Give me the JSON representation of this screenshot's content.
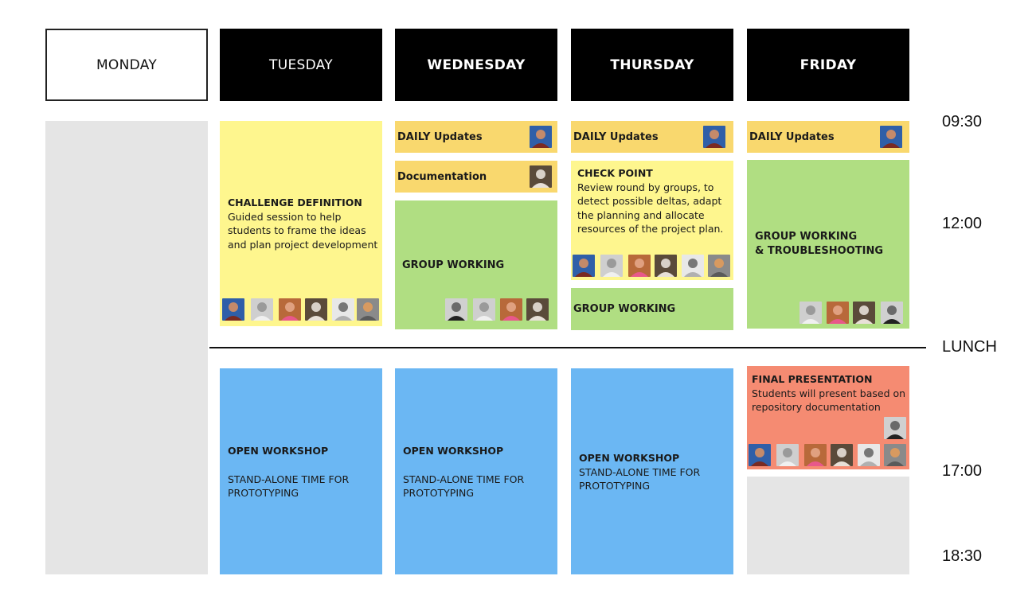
{
  "days": {
    "monday": "MONDAY",
    "tuesday": "TUESDAY",
    "wednesday": "WEDNESDAY",
    "thursday": "THURSDAY",
    "friday": "FRIDAY"
  },
  "times": {
    "t0930": "09:30",
    "t1200": "12:00",
    "lunch": "LUNCH",
    "t1700": "17:00",
    "t1830": "18:30"
  },
  "tuesday": {
    "challenge_title": "CHALLENGE DEFINITION",
    "challenge_desc": "Guided session to help students to frame the ideas and plan project development",
    "workshop_title": "OPEN WORKSHOP",
    "workshop_desc": "STAND-ALONE TIME FOR PROTOTYPING"
  },
  "wednesday": {
    "daily": "DAILY Updates",
    "documentation": "Documentation",
    "group_working": "GROUP WORKING",
    "workshop_title": "OPEN WORKSHOP",
    "workshop_desc": "STAND-ALONE TIME FOR PROTOTYPING"
  },
  "thursday": {
    "daily": "DAILY Updates",
    "checkpoint_title": "CHECK POINT",
    "checkpoint_desc": "Review round by groups, to detect possible deltas, adapt the planning and allocate resources of the project plan.",
    "group_working": "GROUP WORKING",
    "workshop_title": "OPEN WORKSHOP",
    "workshop_desc": "STAND-ALONE TIME FOR PROTOTYPING"
  },
  "friday": {
    "daily": "DAILY Updates",
    "group_working_line1": "GROUP WORKING",
    "group_working_line2": "& TROUBLESHOOTING",
    "final_title": "FINAL PRESENTATION",
    "final_desc": "Students will present based on repository documentation"
  },
  "colors": {
    "header_black": "#000000",
    "monday_grey": "#e5e5e5",
    "session_yellow": "#fef68e",
    "daily_orange": "#f9d86e",
    "group_green": "#b0de82",
    "workshop_blue": "#6bb7f3",
    "final_salmon": "#f58b72"
  },
  "icons": {
    "avatar": "person-avatar-icon"
  }
}
